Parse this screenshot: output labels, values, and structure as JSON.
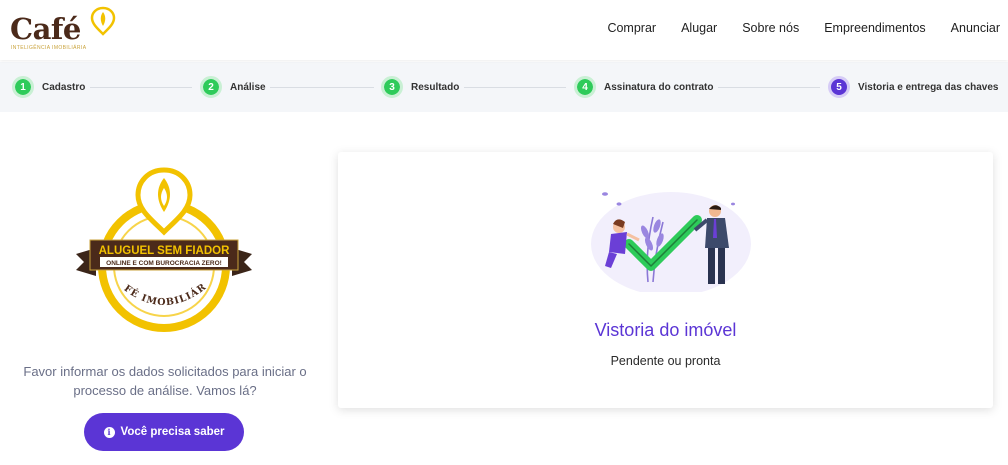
{
  "header": {
    "logo_text": "Café",
    "logo_tagline": "INTELIGÊNCIA IMOBILIÁRIA",
    "nav": [
      "Comprar",
      "Alugar",
      "Sobre nós",
      "Empreendimentos",
      "Anunciar"
    ]
  },
  "stepper": {
    "steps": [
      {
        "number": "1",
        "label": "Cadastro",
        "status": "done"
      },
      {
        "number": "2",
        "label": "Análise",
        "status": "done"
      },
      {
        "number": "3",
        "label": "Resultado",
        "status": "done"
      },
      {
        "number": "4",
        "label": "Assinatura do contrato",
        "status": "done"
      },
      {
        "number": "5",
        "label": "Vistoria e entrega das chaves",
        "status": "active"
      }
    ]
  },
  "badge": {
    "ribbon_line1": "ALUGUEL SEM FIADOR",
    "ribbon_line2": "ONLINE E COM BUROCRACIA ZERO!",
    "brand": "CAFÉ IMOBILIÁRIA"
  },
  "left": {
    "intro": "Favor informar os dados solicitados para iniciar o processo de análise. Vamos lá?",
    "cta_label": "Você precisa saber"
  },
  "card": {
    "title": "Vistoria do imóvel",
    "subtitle": "Pendente ou pronta"
  },
  "colors": {
    "primary": "#5b35d5",
    "success": "#2ecb5a",
    "brand_brown": "#4b2a1a",
    "brand_gold": "#f2c200"
  }
}
